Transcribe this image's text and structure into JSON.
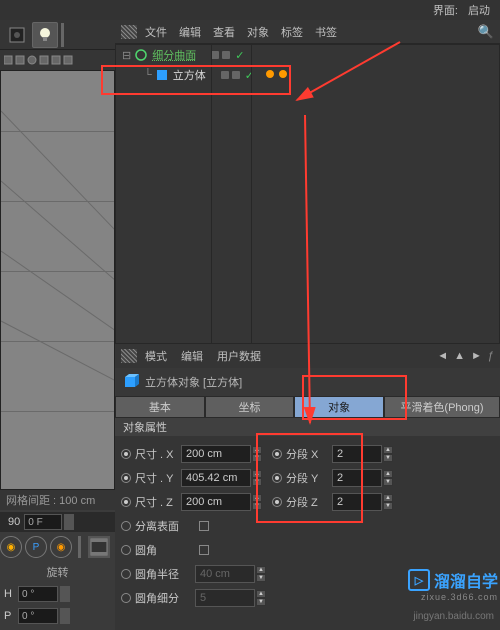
{
  "top": {
    "ui_label": "界面:",
    "launch": "启动"
  },
  "objmenu": {
    "file": "文件",
    "edit": "编辑",
    "view": "查看",
    "object": "对象",
    "tags": "标签",
    "bookmark": "书签"
  },
  "tree": {
    "parent": "细分曲面",
    "child": "立方体"
  },
  "attrmenu": {
    "mode": "模式",
    "edit": "编辑",
    "userdata": "用户数据"
  },
  "object_title": "立方体对象 [立方体]",
  "tabs": {
    "base": "基本",
    "coord": "坐标",
    "object": "对象",
    "phong": "平滑着色(Phong)"
  },
  "section": "对象属性",
  "props": {
    "sizeX": {
      "label": "尺寸 . X",
      "value": "200 cm"
    },
    "sizeY": {
      "label": "尺寸 . Y",
      "value": "405.42 cm"
    },
    "sizeZ": {
      "label": "尺寸 . Z",
      "value": "200 cm"
    },
    "segX": {
      "label": "分段 X",
      "value": "2"
    },
    "segY": {
      "label": "分段 Y",
      "value": "2"
    },
    "segZ": {
      "label": "分段 Z",
      "value": "2"
    },
    "separate": "分离表面",
    "fillet": "圆角",
    "fillet_radius_label": "圆角半径",
    "fillet_radius_val": "40 cm",
    "fillet_sub_label": "圆角细分",
    "fillet_sub_val": "5"
  },
  "viewport": {
    "grid": "网格间距 : 100 cm",
    "frame": "90",
    "temp": "0 F",
    "rotate": "旋转",
    "H": "H",
    "P": "P",
    "deg": "0 °"
  },
  "watermark": {
    "brand": "溜溜自学",
    "url": "zixue.3d66.com",
    "small": "jingyan.baidu.com"
  }
}
